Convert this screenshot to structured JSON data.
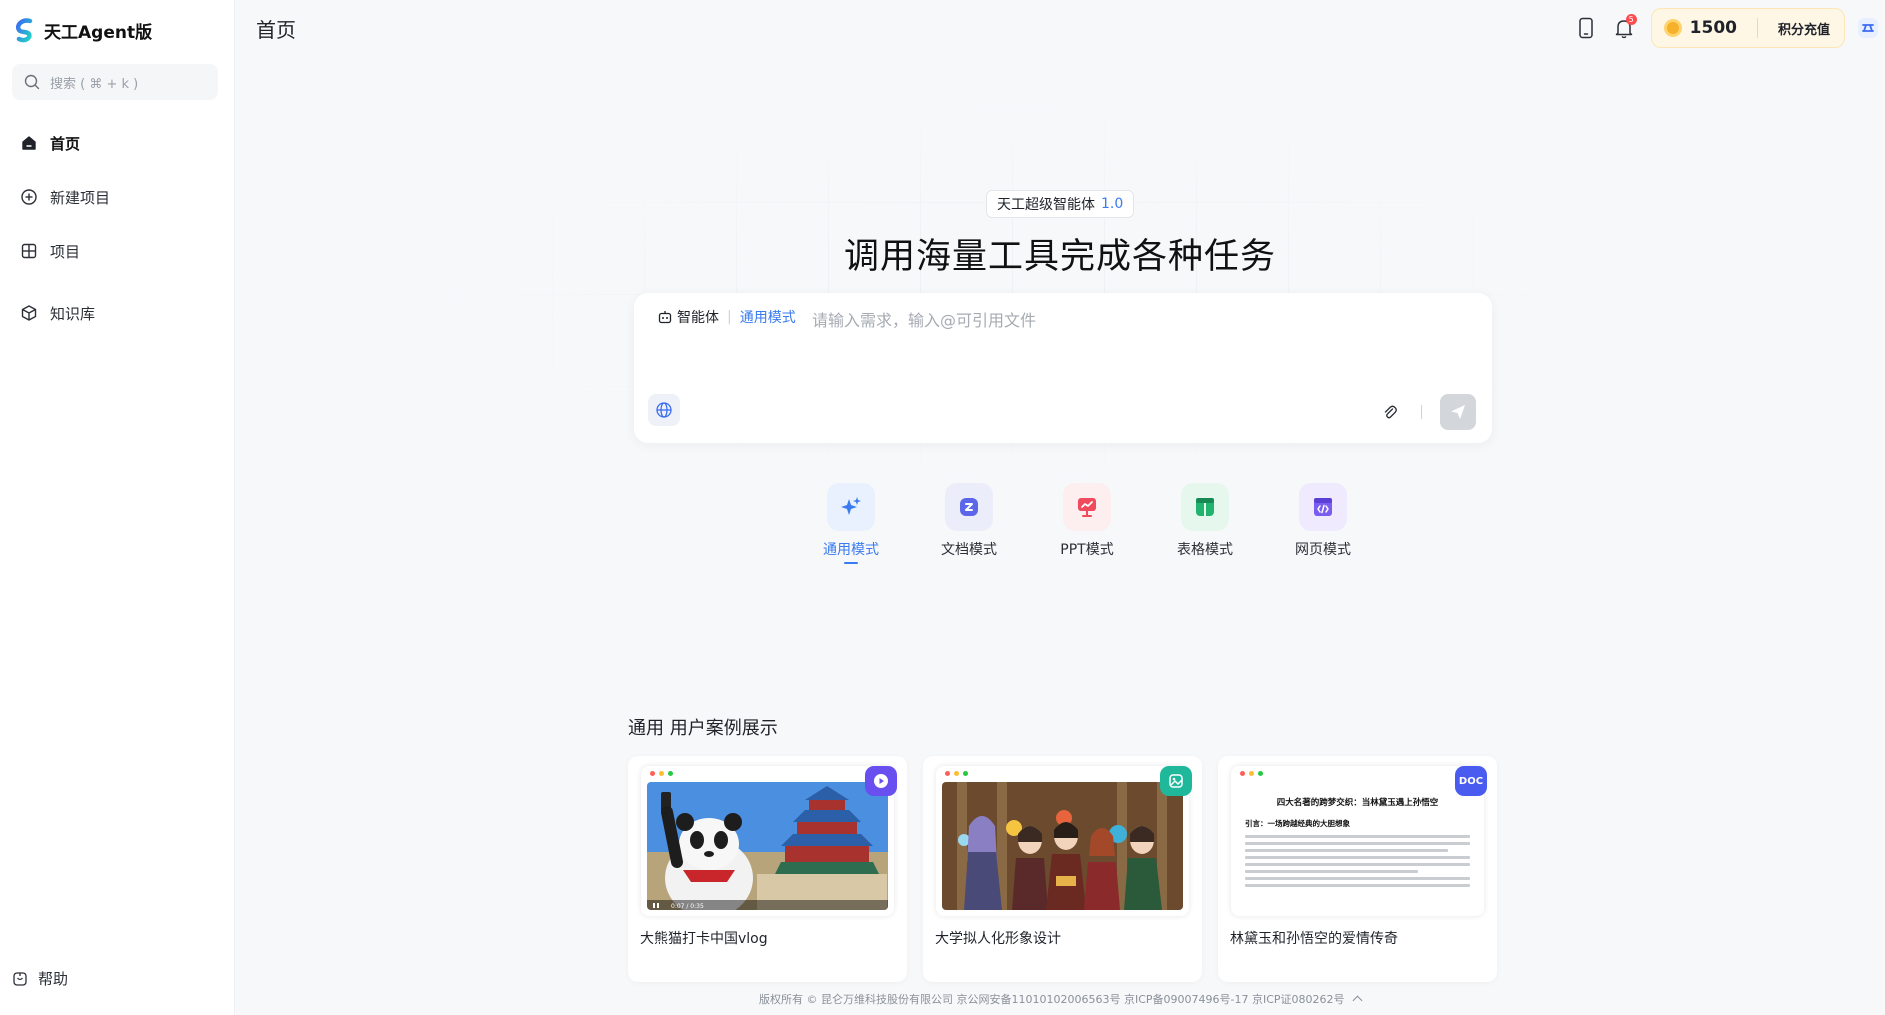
{
  "app": {
    "name": "天工Agent版"
  },
  "sidebar": {
    "search_placeholder": "搜索 ( ⌘ + k )",
    "items": [
      {
        "label": "首页",
        "icon": "home-icon",
        "active": true
      },
      {
        "label": "新建项目",
        "icon": "plus-circle-icon"
      },
      {
        "label": "项目",
        "icon": "grid-icon"
      },
      {
        "label": "知识库",
        "icon": "cube-icon"
      }
    ],
    "help_label": "帮助"
  },
  "header": {
    "title": "首页",
    "notification_count": "5",
    "points": "1500",
    "recharge_label": "积分充值"
  },
  "hero": {
    "badge_text": "天工超级智能体",
    "badge_version": "1.0",
    "title": "调用海量工具完成各种任务"
  },
  "input": {
    "agent_label": "智能体",
    "mode_label": "通用模式",
    "placeholder": "请输入需求，输入@可引用文件"
  },
  "modes": [
    {
      "label": "通用模式",
      "icon": "sparkle-icon",
      "active": true,
      "color": "#3a7bf0",
      "bg": "#eaf1fe"
    },
    {
      "label": "文档模式",
      "icon": "document-icon",
      "color": "#5b67e8",
      "bg": "#ebedfb"
    },
    {
      "label": "PPT模式",
      "icon": "presentation-icon",
      "color": "#ef4b5c",
      "bg": "#fdeef0"
    },
    {
      "label": "表格模式",
      "icon": "table-icon",
      "color": "#22b46e",
      "bg": "#e6f7ee"
    },
    {
      "label": "网页模式",
      "icon": "code-icon",
      "color": "#7a5cf0",
      "bg": "#efeafe"
    }
  ],
  "cases": {
    "title": "通用 用户案例展示",
    "items": [
      {
        "label": "大熊猫打卡中国vlog",
        "type": "video",
        "badge_color": "#6a4ff0",
        "video_time": "0:07 / 0:35"
      },
      {
        "label": "大学拟人化形象设计",
        "type": "image",
        "badge_color": "#1fb89a"
      },
      {
        "label": "林黛玉和孙悟空的爱情传奇",
        "type": "doc",
        "badge_color": "#4a5cf0",
        "badge_text": "DOC",
        "doc_title": "四大名著的跨梦交织：当林黛玉遇上孙悟空",
        "doc_subtitle": "引言：一场跨越经典的大胆想象"
      }
    ]
  },
  "footer": {
    "text": "版权所有 © 昆仑万维科技股份有限公司 京公网安备11010102006563号 京ICP备09007496号-17 京ICP证080262号"
  }
}
